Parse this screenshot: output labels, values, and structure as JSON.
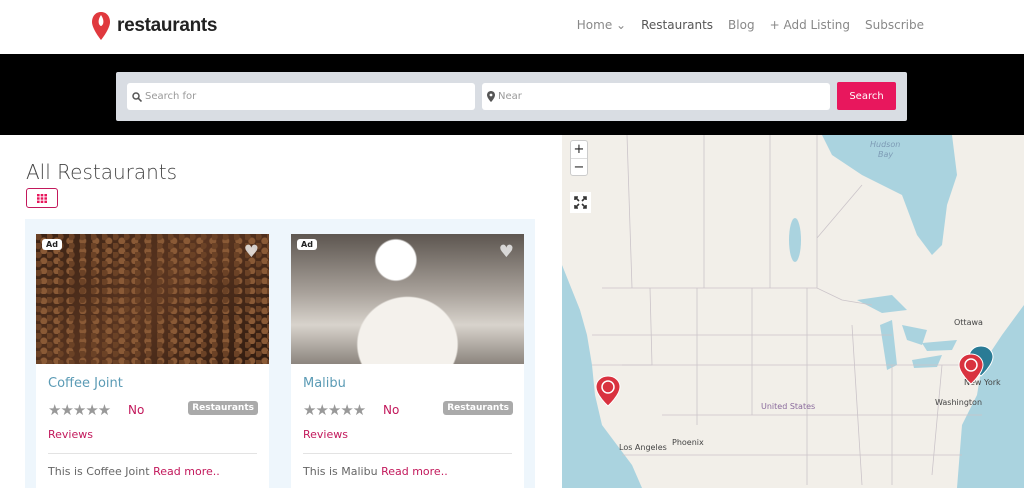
{
  "header": {
    "logo_text": "restaurants",
    "nav": [
      "Home",
      "Restaurants",
      "Blog",
      "+ Add Listing",
      "Subscribe"
    ]
  },
  "search": {
    "what_placeholder": "Search for",
    "near_placeholder": "Near",
    "button": "Search"
  },
  "main": {
    "title": "All Restaurants"
  },
  "cards": [
    {
      "ad": "Ad",
      "name": "Coffee Joint",
      "rating_text": "No",
      "reviews_text": "Reviews",
      "category": "Restaurants",
      "desc": "This is Coffee Joint",
      "read_more": "Read more.."
    },
    {
      "ad": "Ad",
      "name": "Malibu",
      "rating_text": "No",
      "reviews_text": "Reviews",
      "category": "Restaurants",
      "desc": "This is Malibu",
      "read_more": "Read more.."
    }
  ],
  "map": {
    "zoom_in": "+",
    "zoom_out": "−",
    "labels": {
      "hudson": "Hudson",
      "bay": "Bay",
      "ottawa": "Ottawa",
      "newyork": "New York",
      "washington": "Washington",
      "us": "United States",
      "phoenix": "Phoenix",
      "la": "Los Angeles"
    }
  },
  "colors": {
    "accent": "#e8175d",
    "link": "#c2185b",
    "title": "#5b9bb5",
    "pin": "#d9323f",
    "pin2": "#2a7b95"
  }
}
